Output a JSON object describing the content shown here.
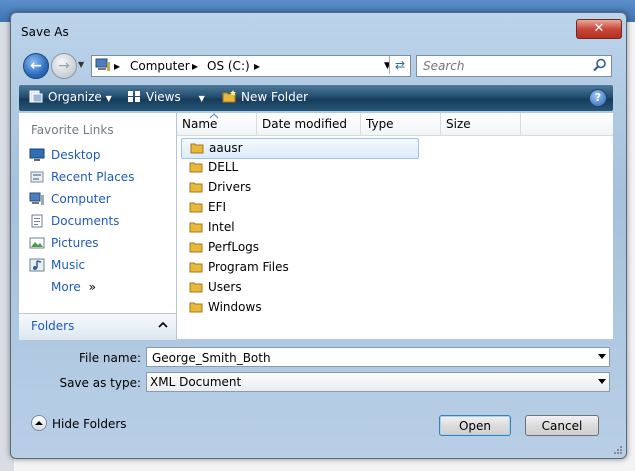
{
  "window": {
    "title": "Save As",
    "close_label": "✕"
  },
  "nav": {
    "crumbs": [
      "Computer",
      "OS (C:)"
    ],
    "search_placeholder": "Search"
  },
  "toolbar": {
    "organize_label": "Organize",
    "views_label": "Views",
    "new_folder_label": "New Folder"
  },
  "favorites": {
    "title": "Favorite Links",
    "items": [
      {
        "label": "Desktop",
        "icon": "desktop-icon"
      },
      {
        "label": "Recent Places",
        "icon": "recent-places-icon"
      },
      {
        "label": "Computer",
        "icon": "computer-icon"
      },
      {
        "label": "Documents",
        "icon": "documents-icon"
      },
      {
        "label": "Pictures",
        "icon": "pictures-icon"
      },
      {
        "label": "Music",
        "icon": "music-icon"
      }
    ],
    "more_label": "More",
    "more_suffix": "»",
    "folders_label": "Folders"
  },
  "columns": [
    "Name",
    "Date modified",
    "Type",
    "Size"
  ],
  "files": [
    {
      "name": "aausr",
      "selected": true
    },
    {
      "name": "DELL"
    },
    {
      "name": "Drivers"
    },
    {
      "name": "EFI"
    },
    {
      "name": "Intel"
    },
    {
      "name": "PerfLogs"
    },
    {
      "name": "Program Files"
    },
    {
      "name": "Users"
    },
    {
      "name": "Windows"
    }
  ],
  "form": {
    "filename_label": "File name:",
    "filename_value": "George_Smith_Both",
    "savetype_label": "Save as type:",
    "savetype_value": "XML Document"
  },
  "footer": {
    "hide_folders_label": "Hide Folders",
    "open_label": "Open",
    "cancel_label": "Cancel"
  },
  "colors": {
    "accent": "#1e5bb8",
    "toolbar": "#244e70",
    "folder": "#e7b83a"
  }
}
